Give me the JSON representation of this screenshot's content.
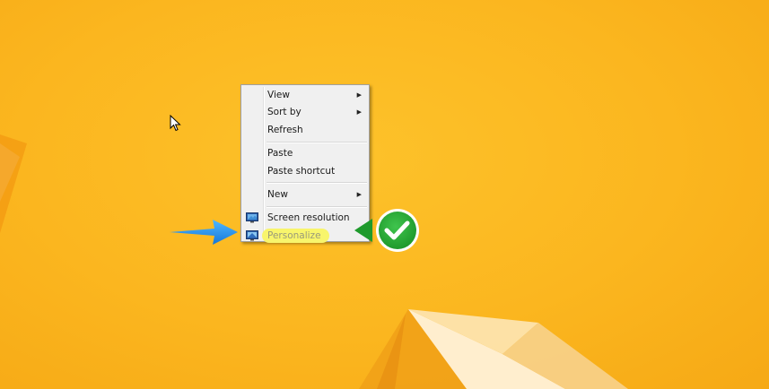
{
  "desktop": {
    "background_color": "#fbb61f"
  },
  "context_menu": {
    "groups": [
      [
        {
          "label": "View",
          "has_submenu": true
        },
        {
          "label": "Sort by",
          "has_submenu": true
        },
        {
          "label": "Refresh",
          "has_submenu": false
        }
      ],
      [
        {
          "label": "Paste",
          "has_submenu": false
        },
        {
          "label": "Paste shortcut",
          "has_submenu": false
        }
      ],
      [
        {
          "label": "New",
          "has_submenu": true
        }
      ],
      [
        {
          "label": "Screen resolution",
          "icon": "monitor-icon",
          "has_submenu": false
        },
        {
          "label": "Personalize",
          "icon": "monitor-icon",
          "has_submenu": false,
          "highlighted": true
        }
      ]
    ],
    "submenu_glyph": "▶"
  },
  "annotations": {
    "arrow_color": "#1e90ff",
    "badge_color": "#28a745",
    "badge_icon": "checkmark-icon"
  }
}
